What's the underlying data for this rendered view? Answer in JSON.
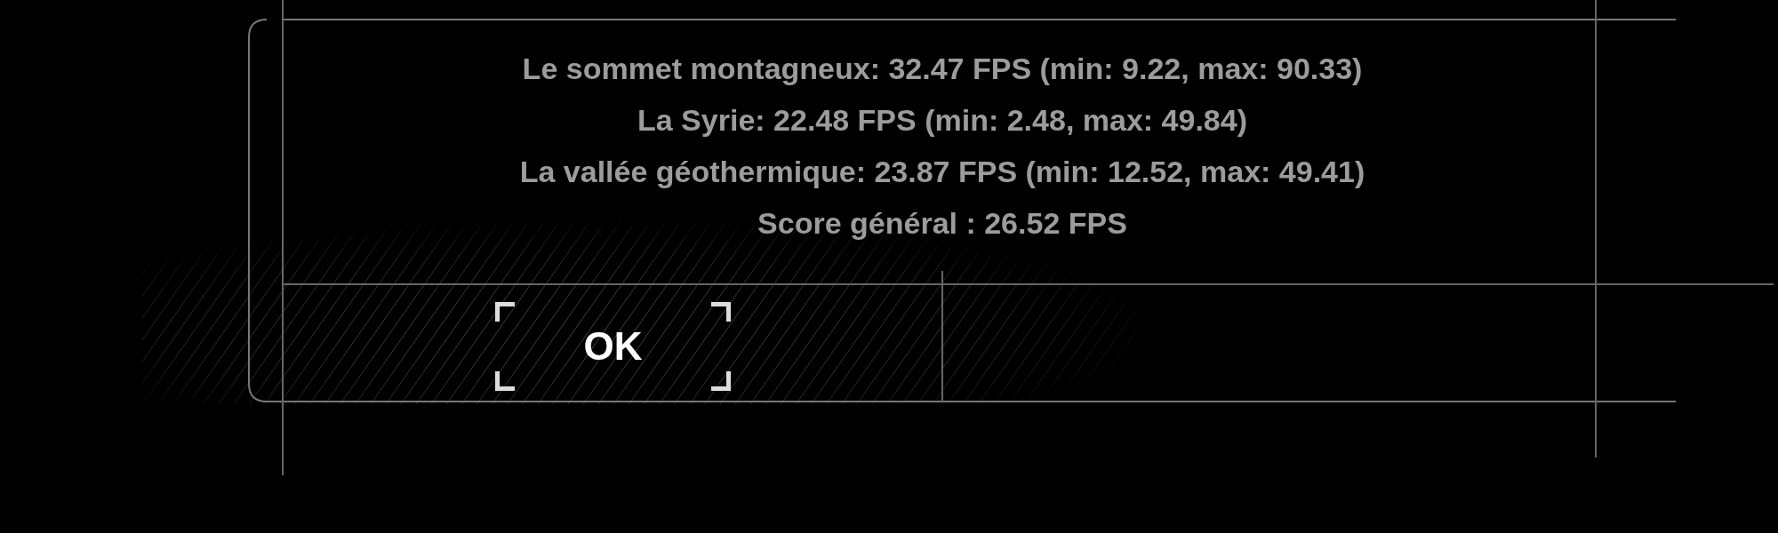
{
  "results": [
    {
      "text": "Le sommet montagneux: 32.47 FPS (min: 9.22, max: 90.33)"
    },
    {
      "text": "La Syrie: 22.48 FPS (min: 2.48, max: 49.84)"
    },
    {
      "text": "La vallée géothermique: 23.87 FPS (min: 12.52, max: 49.41)"
    }
  ],
  "overall": "Score général : 26.52 FPS",
  "buttons": [
    {
      "label": "OK",
      "focused": true
    }
  ]
}
